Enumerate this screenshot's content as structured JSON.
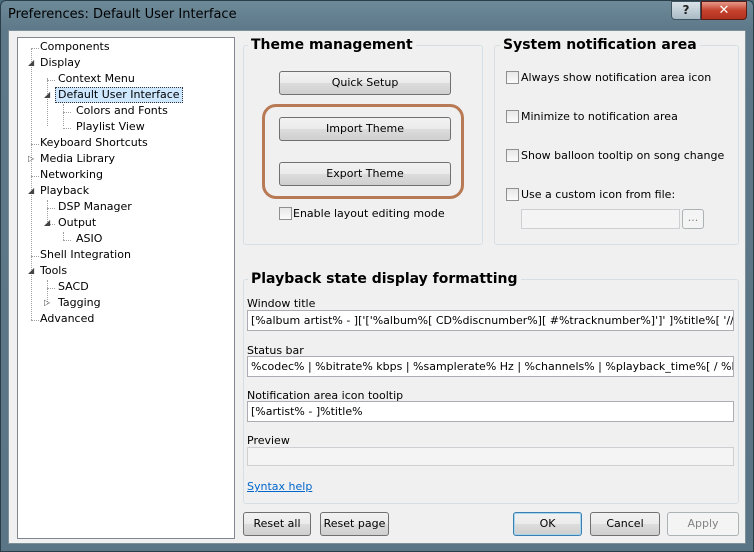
{
  "window": {
    "title": "Preferences: Default User Interface",
    "help_label": "?",
    "close_label": "✕"
  },
  "tree": {
    "items": [
      {
        "label": "Components"
      },
      {
        "label": "Display",
        "expander": "◢"
      },
      {
        "label": "Context Menu"
      },
      {
        "label": "Default User Interface",
        "expander": "◢"
      },
      {
        "label": "Colors and Fonts"
      },
      {
        "label": "Playlist View"
      },
      {
        "label": "Keyboard Shortcuts"
      },
      {
        "label": "Media Library",
        "expander": "▷"
      },
      {
        "label": "Networking"
      },
      {
        "label": "Playback",
        "expander": "◢"
      },
      {
        "label": "DSP Manager"
      },
      {
        "label": "Output",
        "expander": "◢"
      },
      {
        "label": "ASIO"
      },
      {
        "label": "Shell Integration"
      },
      {
        "label": "Tools",
        "expander": "◢"
      },
      {
        "label": "SACD"
      },
      {
        "label": "Tagging",
        "expander": "▷"
      },
      {
        "label": "Advanced"
      }
    ],
    "selected": "Default User Interface"
  },
  "theme": {
    "title": "Theme management",
    "quick_setup": "Quick Setup",
    "import": "Import Theme",
    "export": "Export Theme",
    "layout_editing": "Enable layout editing mode",
    "layout_editing_checked": false
  },
  "notification": {
    "title": "System notification area",
    "always_show": "Always show notification area icon",
    "minimize": "Minimize to notification area",
    "balloon": "Show balloon tooltip on song change",
    "custom_icon": "Use a custom icon from file:",
    "custom_icon_path": "",
    "browse": "..."
  },
  "formatting": {
    "title": "Playback state display formatting",
    "window_title_label": "Window title",
    "window_title_value": "[%album artist% - ]['['%album%[ CD%discnumber%][ #%tracknumber%]']' ]%title%[ '//' %track a",
    "status_bar_label": "Status bar",
    "status_bar_value": "%codec% | %bitrate% kbps | %samplerate% Hz | %channels% | %playback_time%[ / %length%",
    "tooltip_label": "Notification area icon tooltip",
    "tooltip_value": "[%artist% - ]%title%",
    "preview_label": "Preview",
    "preview_value": "",
    "syntax_help": "Syntax help"
  },
  "footer": {
    "reset_all": "Reset all",
    "reset_page": "Reset page",
    "ok": "OK",
    "cancel": "Cancel",
    "apply": "Apply"
  },
  "colors": {
    "highlight_ring": "#b87a55",
    "selection": "#cde8ff",
    "link": "#0066cc"
  }
}
